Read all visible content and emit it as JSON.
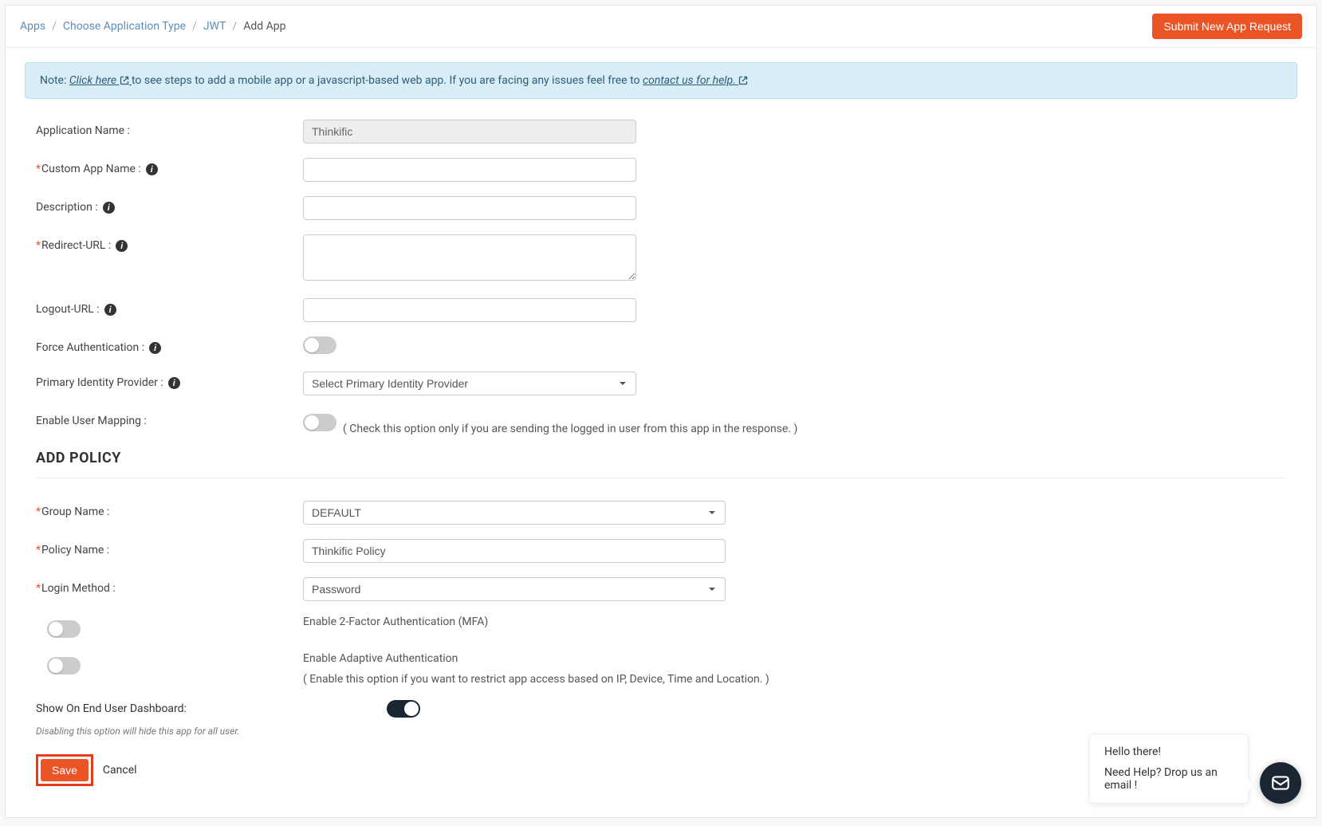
{
  "breadcrumb": {
    "items": [
      "Apps",
      "Choose Application Type",
      "JWT"
    ],
    "current": "Add App"
  },
  "actions": {
    "submit_request": "Submit New App Request",
    "save": "Save",
    "cancel": "Cancel"
  },
  "note": {
    "prefix": "Note: ",
    "click_here": "Click here",
    "mid": " to see steps to add a mobile app or a javascript-based web app. If you are facing any issues feel free to ",
    "contact": "contact us for help."
  },
  "form": {
    "app_name": {
      "label": "Application Name :",
      "value": "Thinkific"
    },
    "custom_app_name": {
      "label": "Custom App Name :",
      "value": ""
    },
    "description": {
      "label": "Description :",
      "value": ""
    },
    "redirect_url": {
      "label": "Redirect-URL :",
      "value": ""
    },
    "logout_url": {
      "label": "Logout-URL :",
      "value": ""
    },
    "force_auth": {
      "label": "Force Authentication :"
    },
    "primary_idp": {
      "label": "Primary Identity Provider :",
      "placeholder": "Select Primary Identity Provider"
    },
    "enable_mapping": {
      "label": "Enable User Mapping :",
      "hint": "( Check this option only if you are sending the logged in user from this app in the response. )"
    }
  },
  "policy": {
    "title": "ADD POLICY",
    "group_name": {
      "label": "Group Name :",
      "value": "DEFAULT"
    },
    "policy_name": {
      "label": "Policy Name :",
      "value": "Thinkific Policy"
    },
    "login_method": {
      "label": "Login Method :",
      "value": "Password"
    },
    "mfa": {
      "label": "Enable 2-Factor Authentication (MFA)"
    },
    "adaptive": {
      "label": "Enable Adaptive Authentication",
      "hint": "( Enable this option if you want to restrict app access based on IP, Device, Time and Location. )"
    }
  },
  "dashboard": {
    "label": "Show On End User Dashboard:",
    "fineprint": "Disabling this option will hide this app for all user."
  },
  "chat": {
    "greeting": "Hello there!",
    "prompt": "Need Help? Drop us an email !"
  }
}
